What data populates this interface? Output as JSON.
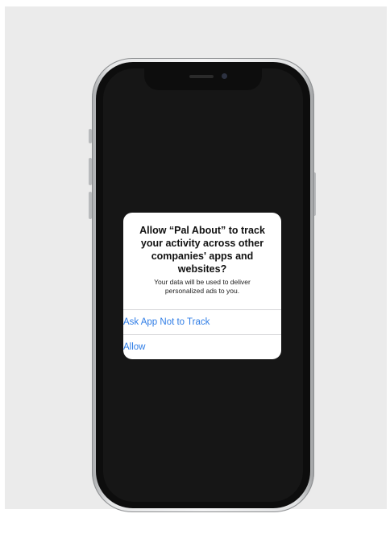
{
  "dialog": {
    "title": "Allow “Pal About” to track your activity across other companies' apps and websites?",
    "message": "Your data will be used to deliver personalized ads to you.",
    "actions": [
      {
        "label": "Ask App Not to Track"
      },
      {
        "label": "Allow"
      }
    ]
  },
  "colors": {
    "background": "#ebebeb",
    "screen": "#161616",
    "alert_background": "#ffffff",
    "action_text": "#2f7de6"
  }
}
